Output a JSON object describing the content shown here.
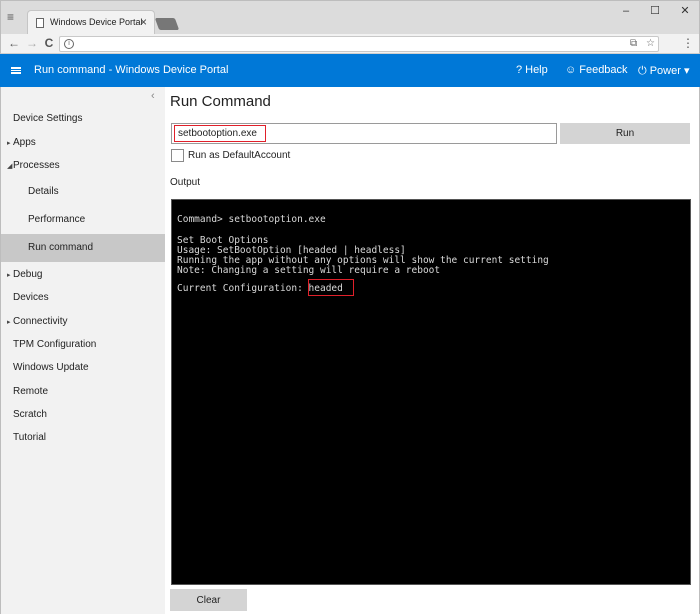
{
  "browser": {
    "tab_title": "Windows Device Portal",
    "tab_close": "×",
    "menu_glyph": "≡",
    "minimize": "–",
    "maximize": "☐",
    "close": "✕",
    "nav": {
      "back": "←",
      "forward": "→",
      "reload": "C"
    },
    "omnibox_info": "i",
    "omnibox_right": [
      "⧉",
      "☆"
    ],
    "kebab": "⋮"
  },
  "appbar": {
    "title": "Run command - Windows Device Portal",
    "help": "Help",
    "help_icon": "?",
    "feedback": "Feedback",
    "feedback_icon": "☺",
    "power": "Power",
    "power_icon": "⏻",
    "power_caret": "▾",
    "accent": "#0078d7"
  },
  "sidebar": {
    "collapse_glyph": "‹",
    "items": [
      {
        "label": "Device Settings",
        "arrow": ""
      },
      {
        "label": "Apps",
        "arrow": "▸"
      },
      {
        "label": "Processes",
        "arrow": "◢"
      },
      {
        "label": "Details",
        "arrow": ""
      },
      {
        "label": "Performance",
        "arrow": ""
      },
      {
        "label": "Run command",
        "arrow": ""
      },
      {
        "label": "Debug",
        "arrow": "▸"
      },
      {
        "label": "Devices",
        "arrow": ""
      },
      {
        "label": "Connectivity",
        "arrow": "▸"
      },
      {
        "label": "TPM Configuration",
        "arrow": ""
      },
      {
        "label": "Windows Update",
        "arrow": ""
      },
      {
        "label": "Remote",
        "arrow": ""
      },
      {
        "label": "Scratch",
        "arrow": ""
      },
      {
        "label": "Tutorial",
        "arrow": ""
      }
    ]
  },
  "main": {
    "title": "Run Command",
    "command_value": "setbootoption.exe",
    "run_label": "Run",
    "checkbox_label": "Run as DefaultAccount",
    "checkbox_checked": false,
    "output_label": "Output",
    "clear_label": "Clear",
    "console": {
      "lines": [
        "Command> setbootoption.exe",
        "Set Boot Options",
        "Usage: SetBootOption [headed | headless]",
        "Running the app without any options will show the current setting",
        "Note: Changing a setting will require a reboot",
        "Current Configuration: headed"
      ],
      "highlight_color": "#e0202a"
    }
  }
}
